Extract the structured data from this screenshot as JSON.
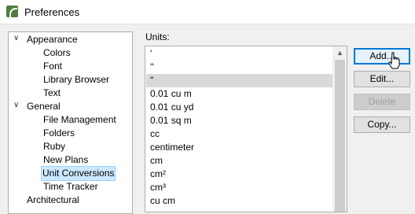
{
  "window": {
    "title": "Preferences",
    "icon": "chief-architect-app-icon"
  },
  "tree": {
    "items": [
      {
        "label": "Appearance",
        "level": 0,
        "expanded": true
      },
      {
        "label": "Colors",
        "level": 1
      },
      {
        "label": "Font",
        "level": 1
      },
      {
        "label": "Library Browser",
        "level": 1
      },
      {
        "label": "Text",
        "level": 1
      },
      {
        "label": "General",
        "level": 0,
        "expanded": true
      },
      {
        "label": "File Management",
        "level": 1
      },
      {
        "label": "Folders",
        "level": 1
      },
      {
        "label": "Ruby",
        "level": 1
      },
      {
        "label": "New Plans",
        "level": 1
      },
      {
        "label": "Unit Conversions",
        "level": 1,
        "selected": true
      },
      {
        "label": "Time Tracker",
        "level": 1
      },
      {
        "label": "Architectural",
        "level": 0
      }
    ]
  },
  "units": {
    "label": "Units:",
    "items": [
      "'",
      "''",
      "\"",
      "0.01 cu m",
      "0.01 cu yd",
      "0.01 sq m",
      "cc",
      "centimeter",
      "cm",
      "cm²",
      "cm³",
      "cu cm"
    ],
    "selected_index": 2
  },
  "buttons": {
    "add": "Add...",
    "edit": "Edit...",
    "delete": "Delete",
    "copy": "Copy..."
  },
  "colors": {
    "selection": "#cce8ff",
    "list_selection": "#d9d9d9",
    "accent": "#0078d7"
  }
}
